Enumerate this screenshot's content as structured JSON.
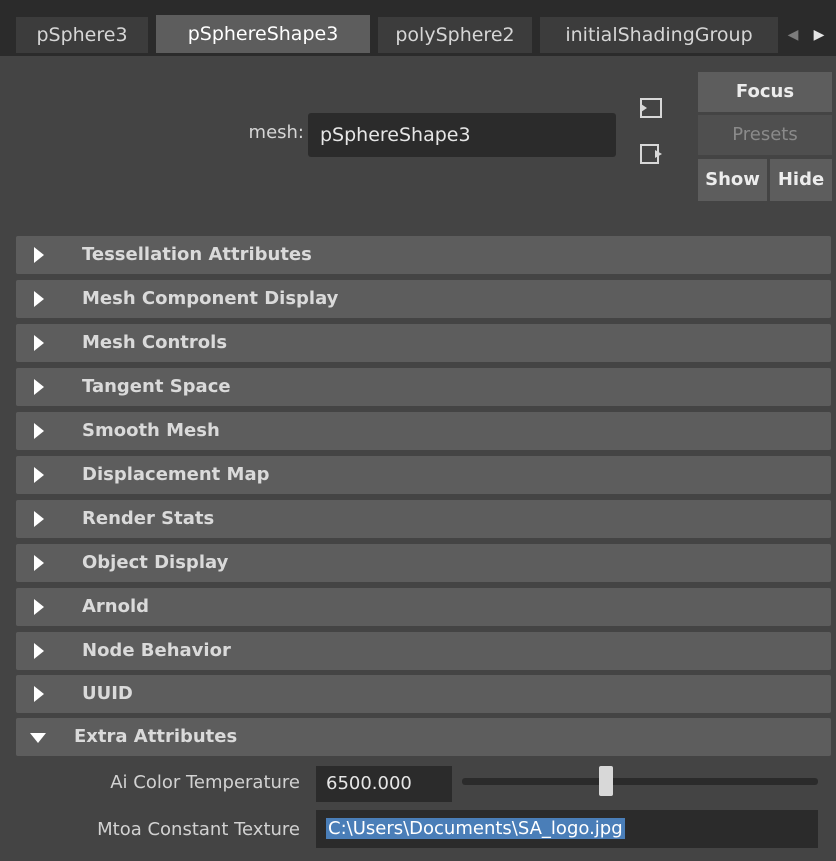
{
  "tabs": [
    {
      "label": "pSphere3",
      "active": false
    },
    {
      "label": "pSphereShape3",
      "active": true
    },
    {
      "label": "polySphere2",
      "active": false
    },
    {
      "label": "initialShadingGroup",
      "active": false
    }
  ],
  "header": {
    "mesh_label": "mesh:",
    "mesh_value": "pSphereShape3",
    "focus_label": "Focus",
    "presets_label": "Presets",
    "show_label": "Show",
    "hide_label": "Hide"
  },
  "sections": [
    {
      "label": "Tessellation Attributes",
      "expanded": false
    },
    {
      "label": "Mesh Component Display",
      "expanded": false
    },
    {
      "label": "Mesh Controls",
      "expanded": false
    },
    {
      "label": "Tangent Space",
      "expanded": false
    },
    {
      "label": "Smooth Mesh",
      "expanded": false
    },
    {
      "label": "Displacement Map",
      "expanded": false
    },
    {
      "label": "Render Stats",
      "expanded": false
    },
    {
      "label": "Object Display",
      "expanded": false
    },
    {
      "label": "Arnold",
      "expanded": false
    },
    {
      "label": "Node Behavior",
      "expanded": false
    },
    {
      "label": "UUID",
      "expanded": false
    },
    {
      "label": "Extra Attributes",
      "expanded": true
    }
  ],
  "extra_attributes": {
    "color_temp_label": "Ai Color Temperature",
    "color_temp_value": "6500.000",
    "color_temp_slider_fraction": 0.4,
    "texture_label": "Mtoa Constant Texture",
    "texture_value": "C:\\Users\\Documents\\SA_logo.jpg"
  },
  "colors": {
    "background": "#444444",
    "tabbar": "#2b2b2b",
    "active_tab": "#5d5d5d",
    "section_header": "#5d5d5d",
    "field": "#2b2b2b",
    "selection": "#4a7eb8"
  },
  "icons": [
    "scroll-left-icon",
    "scroll-right-icon",
    "copy-tab-icon",
    "go-to-output-icon",
    "expand-arrow-icon",
    "collapse-arrow-icon"
  ]
}
